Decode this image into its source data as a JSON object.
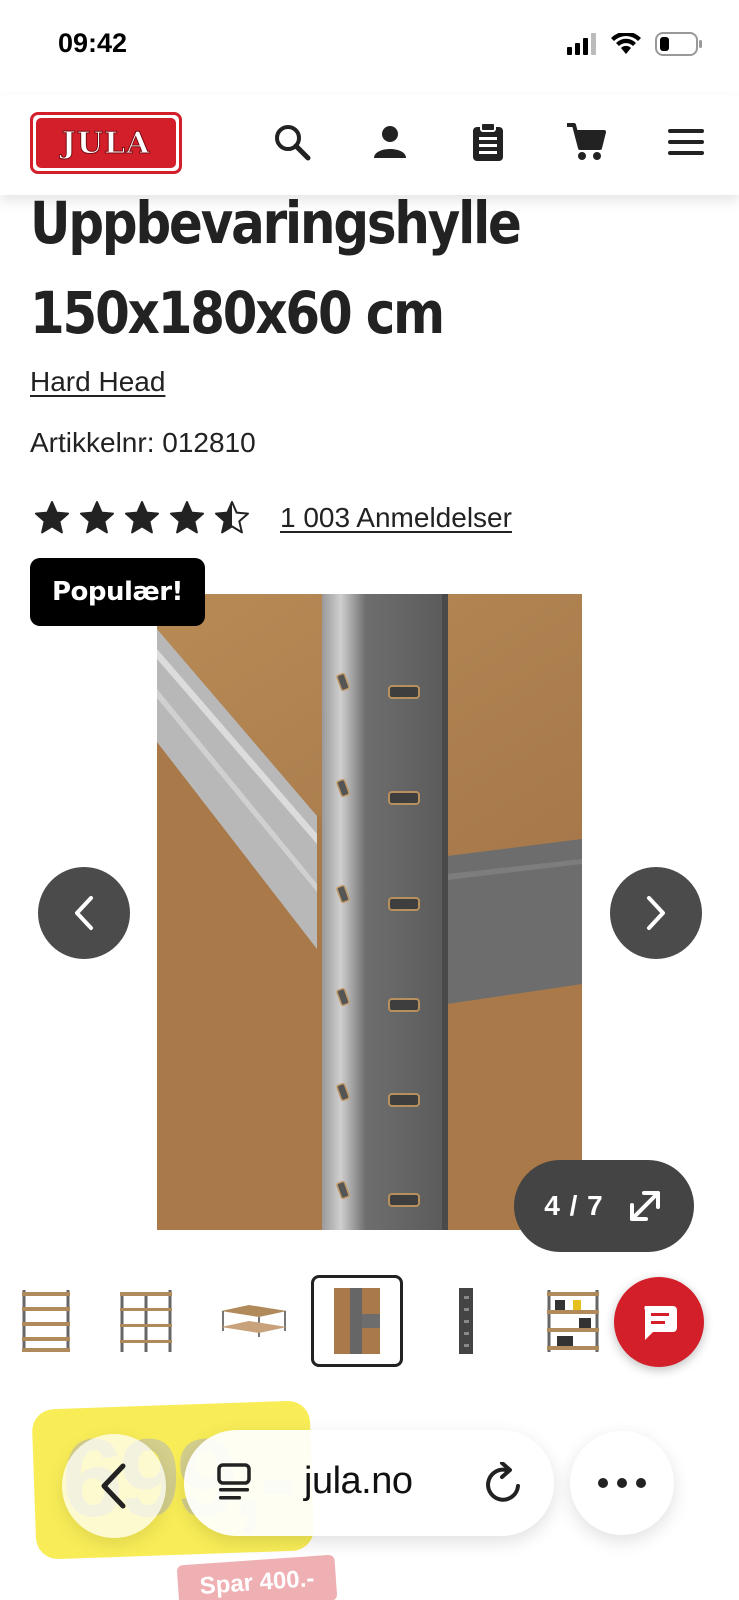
{
  "status_bar": {
    "time": "09:42"
  },
  "header": {
    "logo_text": "JULA",
    "icons": [
      "search-icon",
      "user-icon",
      "clipboard-icon",
      "cart-icon",
      "menu-icon"
    ]
  },
  "product": {
    "title_line1": "Uppbevaringshylle",
    "title_line2": "150x180x60 cm",
    "brand": "Hard Head",
    "article_number": "Artikkelnr: 012810",
    "rating_value": 4.5,
    "rating_max": 5,
    "reviews_label": "1 003 Anmeldelser"
  },
  "gallery": {
    "badge": "Populær!",
    "counter": "4 / 7",
    "current_index": 4,
    "total": 7,
    "thumbnails": [
      "shelf-front",
      "shelf-angle",
      "shelf-corner",
      "shelf-detail",
      "shelf-post",
      "shelf-loaded"
    ]
  },
  "price": {
    "amount": "699,-",
    "save_label": "Spar 400.-"
  },
  "browser": {
    "url": "jula.no"
  },
  "colors": {
    "brand_red": "#d31f2a",
    "price_yellow": "#f7ea3a",
    "dark_button": "#4b4b4b"
  }
}
